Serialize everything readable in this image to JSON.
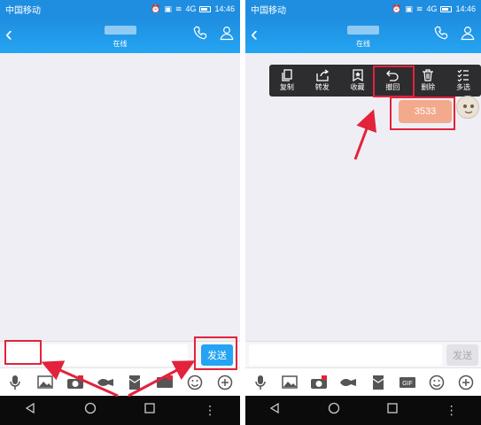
{
  "status_bar": {
    "carrier": "中国移动",
    "time": "14:46",
    "network": "4G"
  },
  "left_screen": {
    "title_bar": {
      "subtitle": "在线"
    },
    "input": {
      "send_label": "发送"
    }
  },
  "right_screen": {
    "title_bar": {
      "subtitle": "在线"
    },
    "context_menu": [
      {
        "label": "复制",
        "icon": "copy-icon"
      },
      {
        "label": "转发",
        "icon": "forward-icon"
      },
      {
        "label": "收藏",
        "icon": "bookmark-icon"
      },
      {
        "label": "撤回",
        "icon": "undo-icon"
      },
      {
        "label": "删除",
        "icon": "trash-icon"
      },
      {
        "label": "多选",
        "icon": "checklist-icon"
      }
    ],
    "message": {
      "text": "3533"
    },
    "input": {
      "send_label": "发送"
    }
  },
  "toolbar_icons": [
    "mic-icon",
    "image-icon",
    "camera-icon",
    "red-packet-icon",
    "hongbao-icon",
    "gif-icon",
    "emoji-icon",
    "plus-icon"
  ],
  "colors": {
    "accent": "#24a4f2",
    "annotation": "#e2233b",
    "menu_bg": "#2d2d2f"
  }
}
